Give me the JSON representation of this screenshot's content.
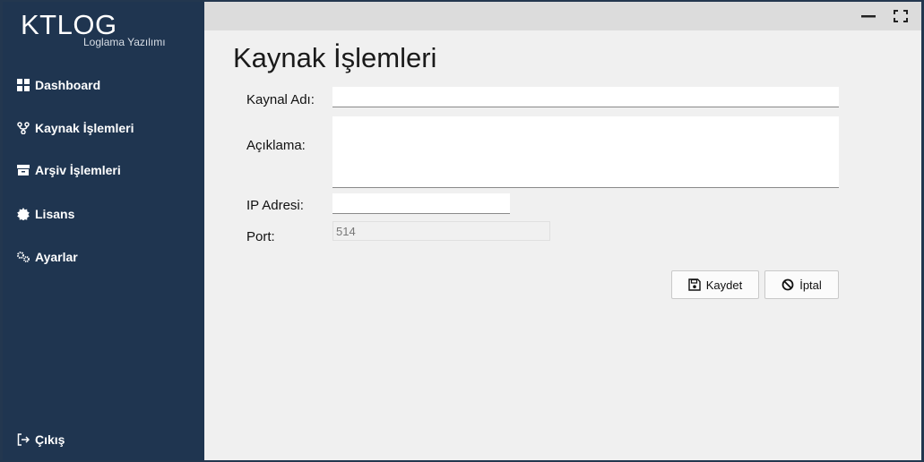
{
  "brand": {
    "title": "KTLOG",
    "subtitle": "Loglama Yazılımı"
  },
  "sidebar": {
    "items": [
      {
        "label": "Dashboard",
        "icon": "dashboard-icon"
      },
      {
        "label": "Kaynak İşlemleri",
        "icon": "source-fork-icon"
      },
      {
        "label": "Arşiv İşlemleri",
        "icon": "archive-icon"
      },
      {
        "label": "Lisans",
        "icon": "certificate-icon"
      },
      {
        "label": "Ayarlar",
        "icon": "gears-icon"
      }
    ],
    "logout": {
      "label": "Çıkış",
      "icon": "sign-out-icon"
    }
  },
  "window_controls": [
    "minimize-icon",
    "fullscreen-icon"
  ],
  "page": {
    "title": "Kaynak İşlemleri",
    "form": {
      "source_name": {
        "label": "Kaynal Adı:",
        "value": ""
      },
      "description": {
        "label": "Açıklama:",
        "value": ""
      },
      "ip_address": {
        "label": "IP Adresi:",
        "value": ""
      },
      "port": {
        "label": "Port:",
        "value": "514"
      }
    },
    "buttons": {
      "save": {
        "label": "Kaydet",
        "icon": "floppy-icon"
      },
      "cancel": {
        "label": "İptal",
        "icon": "ban-icon"
      }
    }
  },
  "colors": {
    "sidebar": "#1f3550",
    "background": "#f0f0f0",
    "topbar": "#dcdcdc"
  }
}
